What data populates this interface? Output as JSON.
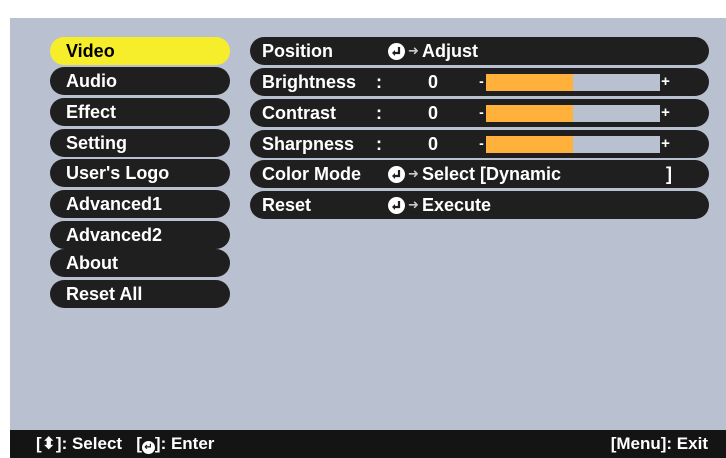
{
  "menu": {
    "items": [
      {
        "label": "Video",
        "active": true
      },
      {
        "label": "Audio",
        "active": false
      },
      {
        "label": "Effect",
        "active": false
      },
      {
        "label": "Setting",
        "active": false
      },
      {
        "label": "User's Logo",
        "active": false
      },
      {
        "label": "Advanced1",
        "active": false
      },
      {
        "label": "Advanced2",
        "active": false
      },
      {
        "label": "About",
        "active": false
      },
      {
        "label": "Reset All",
        "active": false
      }
    ]
  },
  "settings": {
    "position": {
      "label": "Position",
      "action": "Adjust",
      "icon": "enter-icon"
    },
    "brightness": {
      "label": "Brightness",
      "value": "0",
      "level": 0.5
    },
    "contrast": {
      "label": "Contrast",
      "value": "0",
      "level": 0.5
    },
    "sharpness": {
      "label": "Sharpness",
      "value": "0",
      "level": 0.5
    },
    "color_mode": {
      "label": "Color Mode",
      "action": "Select [Dynamic",
      "bracket_end": "]",
      "icon": "enter-icon"
    },
    "reset": {
      "label": "Reset",
      "action": "Execute",
      "icon": "enter-icon"
    }
  },
  "slider": {
    "minus": "-",
    "plus": "+"
  },
  "footer": {
    "select_open": "[",
    "select_close": "]: Select",
    "enter_open": "[",
    "enter_close": "]: Enter",
    "exit": "[Menu]: Exit"
  },
  "colors": {
    "panel": "#b9c0d0",
    "item": "#1f1f1f",
    "active": "#f6ee2a",
    "slider_fill": "#ffb13b",
    "footer": "#141414"
  }
}
